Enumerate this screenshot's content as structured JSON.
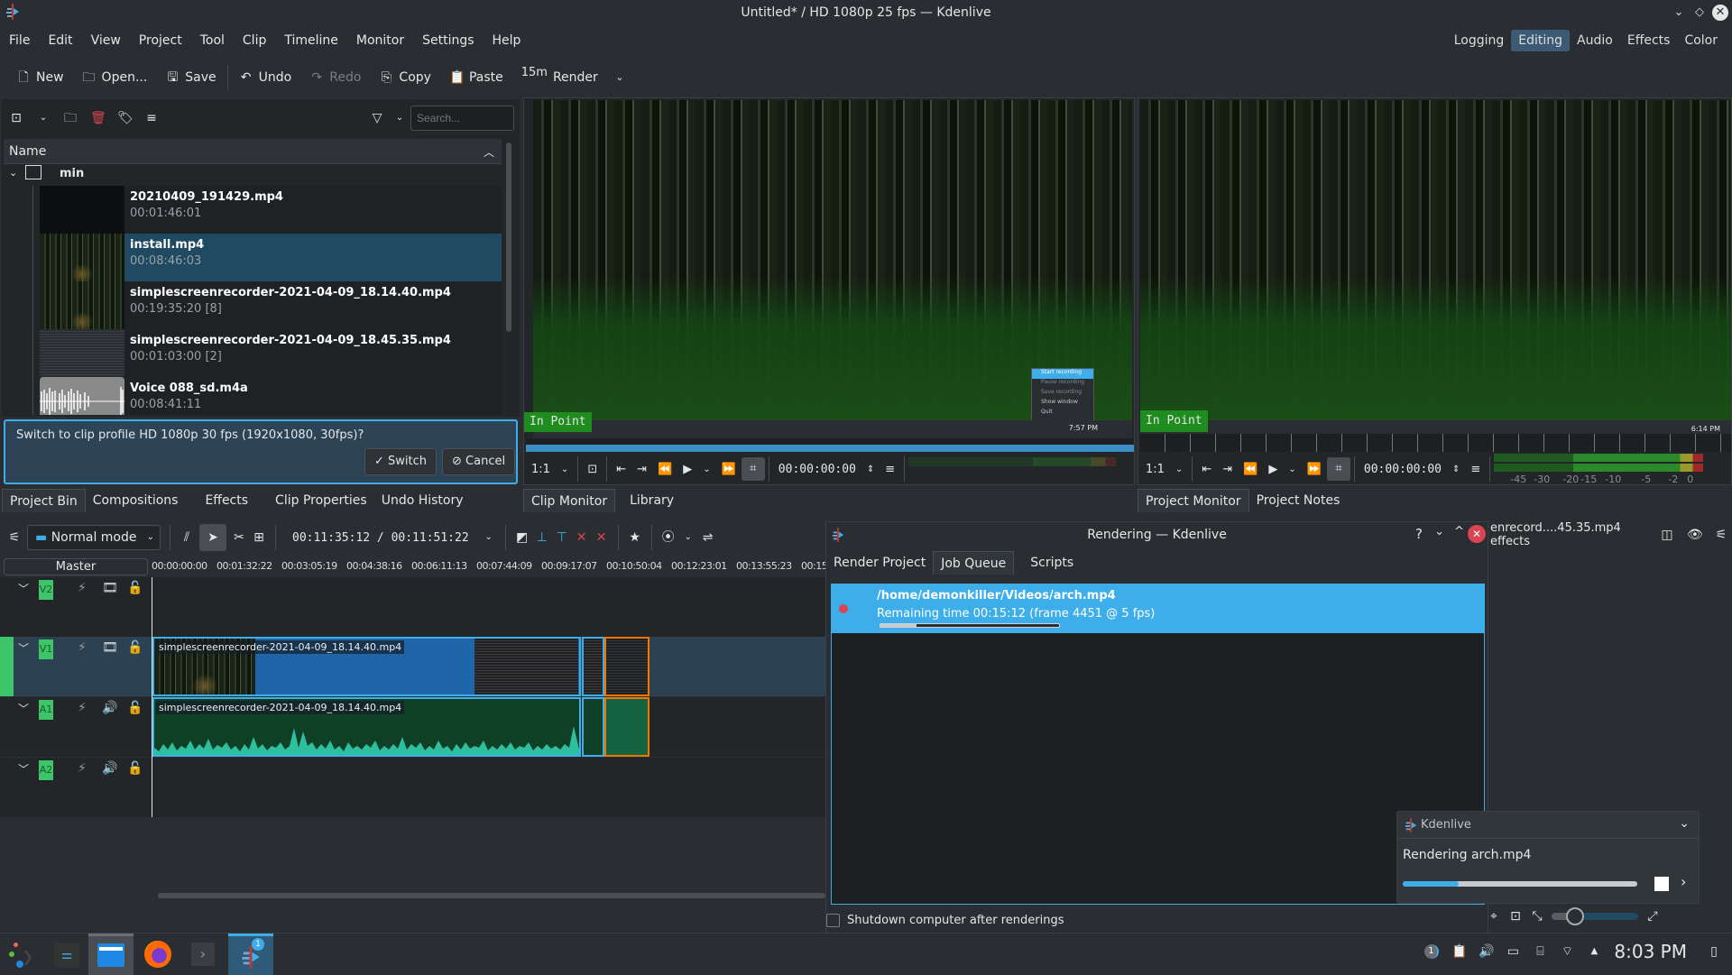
{
  "window": {
    "title": "Untitled* / HD 1080p 25 fps — Kdenlive"
  },
  "menu": [
    "File",
    "Edit",
    "View",
    "Project",
    "Tool",
    "Clip",
    "Timeline",
    "Monitor",
    "Settings",
    "Help"
  ],
  "layouts": {
    "items": [
      "Logging",
      "Editing",
      "Audio",
      "Effects",
      "Color"
    ],
    "active": "Editing"
  },
  "toolbar": {
    "new": "New",
    "open": "Open...",
    "save": "Save",
    "undo": "Undo",
    "redo": "Redo",
    "copy": "Copy",
    "paste": "Paste",
    "render_badge": "15m",
    "render": "Render"
  },
  "bin": {
    "search_placeholder": "Search...",
    "column_name": "Name",
    "folder": "min",
    "clips": [
      {
        "name": "20210409_191429.mp4",
        "duration": "00:01:46:01",
        "selected": false
      },
      {
        "name": "install.mp4",
        "duration": "00:08:46:03",
        "selected": true
      },
      {
        "name": "simplescreenrecorder-2021-04-09_18.14.40.mp4",
        "duration": "00:19:35:20 [8]",
        "selected": false
      },
      {
        "name": "simplescreenrecorder-2021-04-09_18.45.35.mp4",
        "duration": "00:01:03:00 [2]",
        "selected": false
      },
      {
        "name": "Voice 088_sd.m4a",
        "duration": "00:08:41:11",
        "selected": false
      }
    ]
  },
  "message": {
    "text": "Switch to clip profile HD 1080p 30 fps (1920x1080, 30fps)?",
    "switch": "Switch",
    "cancel": "Cancel"
  },
  "left_tabs": [
    "Project Bin",
    "Compositions",
    "Effects",
    "Clip Properties",
    "Undo History"
  ],
  "clip_monitor": {
    "in_point": "In Point",
    "zoom": "1:1",
    "timecode": "00:00:00:00",
    "overlay_menu": [
      "Start recording",
      "Pause recording",
      "Save recording",
      "Show window",
      "Quit"
    ],
    "overlay_clock": "7:57 PM",
    "tabs": [
      "Clip Monitor",
      "Library"
    ]
  },
  "project_monitor": {
    "in_point": "In Point",
    "zoom": "1:1",
    "timecode": "00:00:00:00",
    "overlay_clock": "6:14 PM",
    "meter_labels": [
      "-45",
      "-30",
      "-20",
      "-15",
      "-10",
      "-5",
      "-2",
      "0"
    ],
    "tabs": [
      "Project Monitor",
      "Project Notes"
    ]
  },
  "timeline": {
    "mode": "Normal mode",
    "position": "00:11:35:12 / 00:11:51:22",
    "master": "Master",
    "ruler": [
      "00:00:00:00",
      "00:01:32:22",
      "00:03:05:19",
      "00:04:38:16",
      "00:06:11:13",
      "00:07:44:09",
      "00:09:17:07",
      "00:10:50:04",
      "00:12:23:01",
      "00:13:55:23",
      "00:15"
    ],
    "tracks": [
      {
        "id": "V2",
        "type": "video"
      },
      {
        "id": "V1",
        "type": "video",
        "clip": "simplescreenrecorder-2021-04-09_18.14.40.mp4"
      },
      {
        "id": "A1",
        "type": "audio",
        "clip": "simplescreenrecorder-2021-04-09_18.14.40.mp4"
      },
      {
        "id": "A2",
        "type": "audio"
      }
    ]
  },
  "render_dialog": {
    "title": "Rendering — Kdenlive",
    "tabs": [
      "Render Project",
      "Job Queue",
      "Scripts"
    ],
    "active_tab": "Job Queue",
    "job": {
      "path": "/home/demonkiller/Videos/arch.mp4",
      "status": "Remaining time 00:15:12 (frame 4451 @ 5 fps)",
      "progress": 0.2
    },
    "shutdown_label": "Shutdown computer after renderings",
    "shutdown_checked": false
  },
  "effects_panel": {
    "title": "enrecord....45.35.mp4 effects"
  },
  "notification": {
    "app": "Kdenlive",
    "text": "Rendering arch.mp4",
    "progress": 0.24
  },
  "taskbar": {
    "clock": "8:03 PM",
    "badge": "1",
    "notif_count": "1"
  },
  "colors": {
    "accent": "#3daee9",
    "in_point": "#1f8c1f",
    "track_label": "#3ec56a",
    "clip_video": "#1e66a8",
    "clip_audio": "#0f3f25",
    "selected_orange": "#f67400",
    "close_red": "#da4453"
  }
}
